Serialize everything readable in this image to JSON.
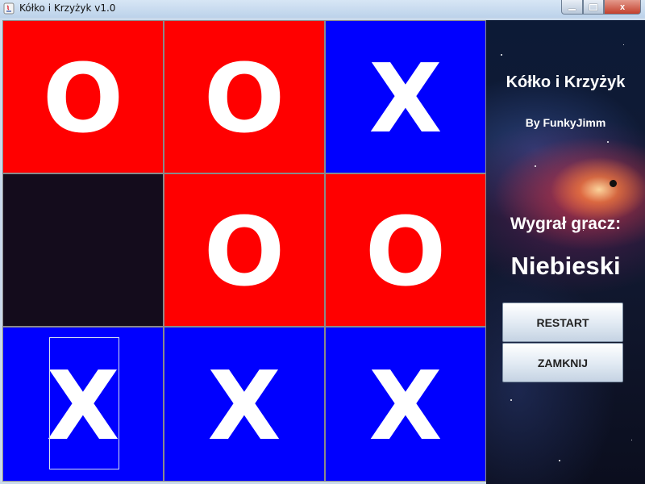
{
  "window": {
    "title": "Kółko i Krzyżyk v1.0",
    "close_glyph": "x"
  },
  "board": {
    "cells": [
      {
        "mark": "O",
        "color": "#ff0000"
      },
      {
        "mark": "O",
        "color": "#ff0000"
      },
      {
        "mark": "X",
        "color": "#0000ff"
      },
      {
        "mark": "",
        "color": "#140c1c"
      },
      {
        "mark": "O",
        "color": "#ff0000"
      },
      {
        "mark": "O",
        "color": "#ff0000"
      },
      {
        "mark": "X",
        "color": "#0000ff"
      },
      {
        "mark": "X",
        "color": "#0000ff"
      },
      {
        "mark": "X",
        "color": "#0000ff"
      }
    ]
  },
  "panel": {
    "title": "Kółko i Krzyżyk",
    "author": "By FunkyJimm",
    "winner_label": "Wygrał gracz:",
    "winner_name": "Niebieski",
    "restart_label": "RESTART",
    "close_label": "ZAMKNIJ"
  }
}
